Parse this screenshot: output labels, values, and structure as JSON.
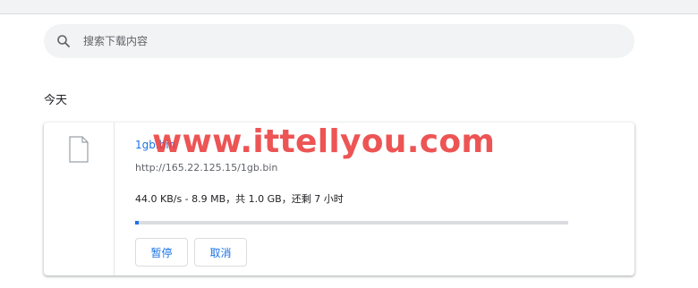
{
  "search": {
    "placeholder": "搜索下载内容"
  },
  "section": {
    "title": "今天"
  },
  "download": {
    "filename": "1gb.bin",
    "url": "http://165.22.125.15/1gb.bin",
    "status": "44.0 KB/s - 8.9 MB，共 1.0 GB，还剩 7 小时",
    "progress_fraction": 0.0087,
    "buttons": {
      "pause": "暂停",
      "cancel": "取消"
    }
  },
  "watermark": {
    "text": "www.ittellyou.com"
  },
  "colors": {
    "accent": "#1a73e8",
    "watermark": "#eb3c3c"
  }
}
